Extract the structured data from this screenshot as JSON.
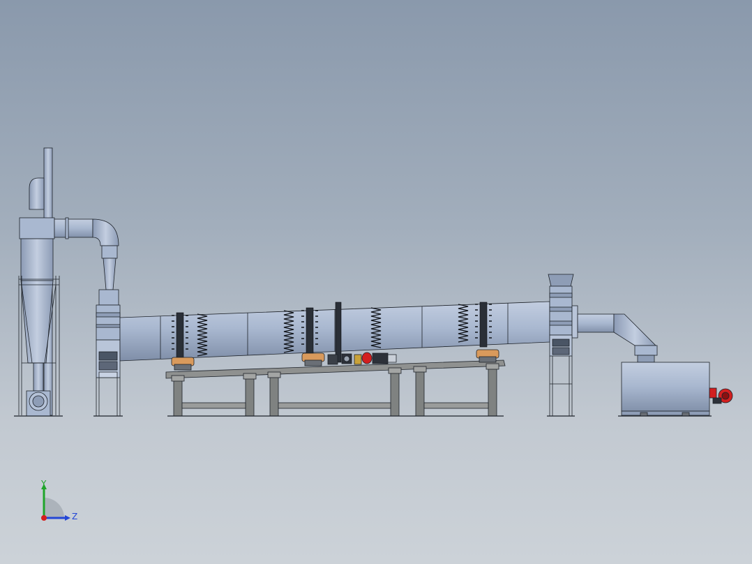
{
  "viewport": {
    "background_top": "#8a99ac",
    "background_bottom": "#ccd2d8"
  },
  "model": {
    "body_color": "#a9b8d0",
    "shade_color": "#8e9db6",
    "outline_color": "#1d2229",
    "frame_color": "#8f9190",
    "roller_color": "#d99a5c",
    "burner_color": "#d21f1f"
  },
  "triad": {
    "y_label": "Y",
    "z_label": "Z",
    "y_color": "#1fa52a",
    "z_color": "#2346d6",
    "x_color": "#d51e1e"
  }
}
